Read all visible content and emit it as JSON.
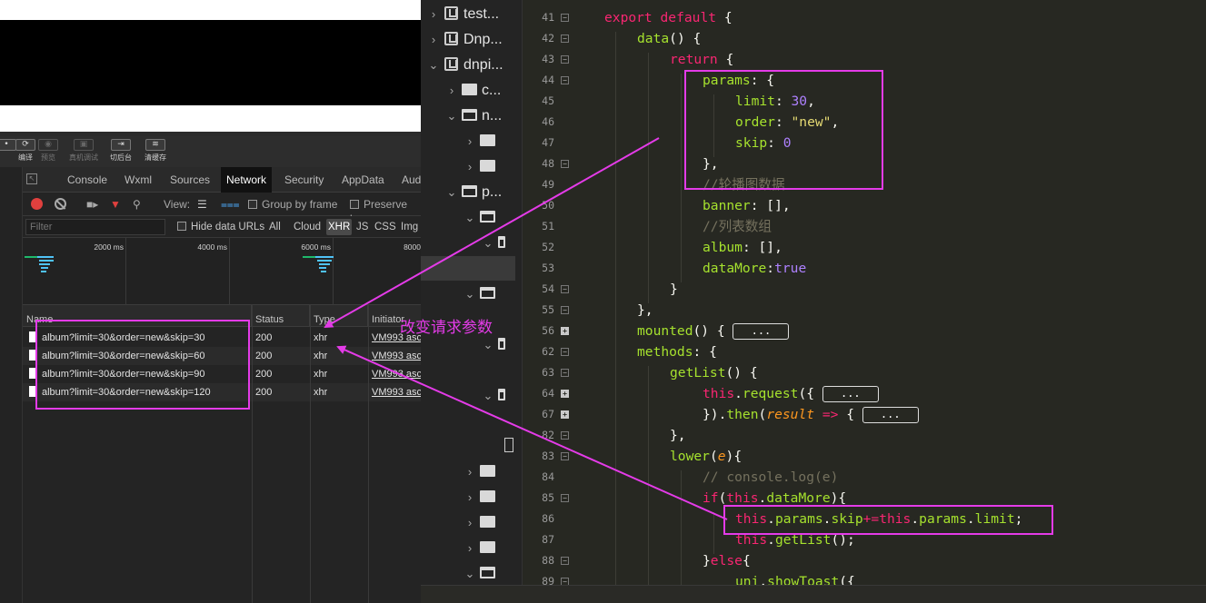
{
  "simulator_toolbar": [
    {
      "label": "编译",
      "icon": "refresh-icon",
      "dim": false
    },
    {
      "label": "预览",
      "icon": "eye-icon",
      "dim": true
    },
    {
      "label": "真机调试",
      "icon": "phone-icon",
      "dim": true
    },
    {
      "label": "切后台",
      "icon": "switch-icon",
      "dim": false
    },
    {
      "label": "清缓存",
      "icon": "stack-icon",
      "dim": false
    }
  ],
  "devtools": {
    "tabs": [
      "Console",
      "Wxml",
      "Sources",
      "Network",
      "Security",
      "AppData",
      "Aud"
    ],
    "active_tab": "Network",
    "view_label": "View:",
    "group_by_frame": "Group by frame",
    "preserve_log": "Preserve log",
    "filter_placeholder": "Filter",
    "hide_data_urls": "Hide data URLs",
    "filter_types": [
      "All",
      "Cloud",
      "XHR",
      "JS",
      "CSS",
      "Img"
    ],
    "selected_filter": "XHR",
    "timeline_ticks": [
      "2000 ms",
      "4000 ms",
      "6000 ms",
      "8000"
    ],
    "columns": [
      "Name",
      "Status",
      "Type",
      "Initiator"
    ],
    "requests": [
      {
        "name": "album?limit=30&order=new&skip=30",
        "status": "200",
        "type": "xhr",
        "initiator": "VM993 asc"
      },
      {
        "name": "album?limit=30&order=new&skip=60",
        "status": "200",
        "type": "xhr",
        "initiator": "VM993 asc"
      },
      {
        "name": "album?limit=30&order=new&skip=90",
        "status": "200",
        "type": "xhr",
        "initiator": "VM993 asc"
      },
      {
        "name": "album?limit=30&order=new&skip=120",
        "status": "200",
        "type": "xhr",
        "initiator": "VM993 asc"
      }
    ]
  },
  "file_tree": {
    "projects": [
      "test...",
      "Dnp...",
      "dnpi..."
    ],
    "folders": [
      "c...",
      "n...",
      "p..."
    ]
  },
  "editor": {
    "collapsed_marker": "...",
    "line_numbers": [
      "41",
      "42",
      "43",
      "44",
      "45",
      "46",
      "47",
      "48",
      "49",
      "50",
      "51",
      "52",
      "53",
      "54",
      "55",
      "56",
      "62",
      "63",
      "64",
      "67",
      "82",
      "83",
      "84",
      "85",
      "86",
      "87",
      "88",
      "89"
    ]
  },
  "annotation": {
    "note": "改变请求参数",
    "color": "#e43be8"
  },
  "colors": {
    "keyword": "#f92672",
    "function": "#a6e22e",
    "number": "#ae81ff",
    "string": "#e6db74",
    "comment": "#75715e",
    "param": "#fd971f"
  }
}
